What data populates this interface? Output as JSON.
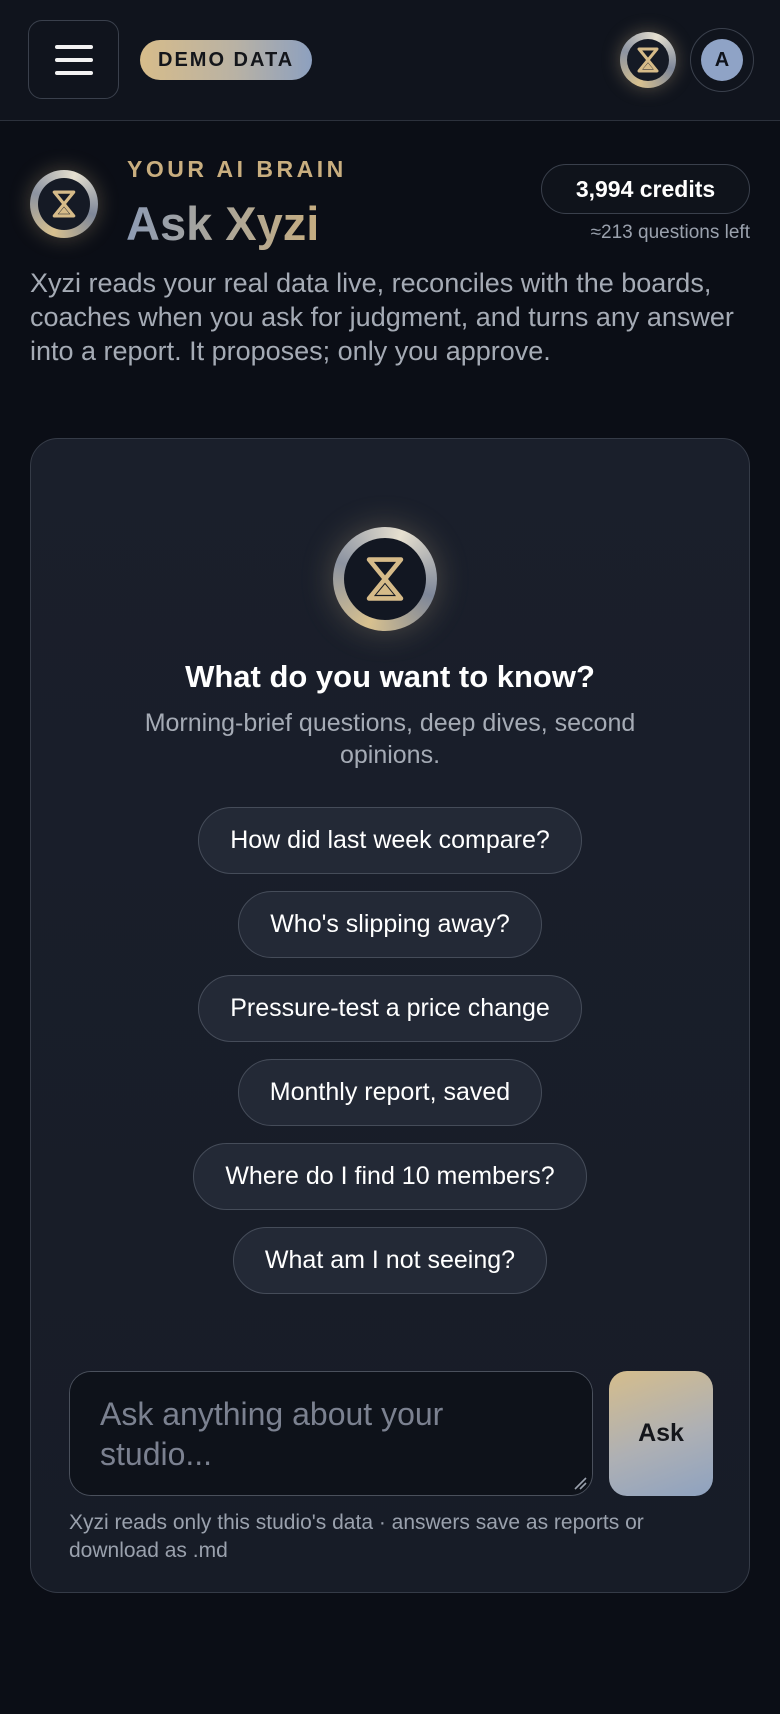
{
  "header": {
    "menu_icon": "hamburger-icon",
    "demo_badge": "DEMO DATA",
    "brand_icon": "hourglass-icon",
    "avatar_initial": "A"
  },
  "hero": {
    "eyebrow": "YOUR AI BRAIN",
    "title": "Ask Xyzi",
    "credits": "3,994 credits",
    "questions_left": "≈213 questions left",
    "description": "Xyzi reads your real data live, reconciles with the boards, coaches when you ask for judgment, and turns any answer into a report. It proposes; only you approve."
  },
  "card": {
    "title": "What do you want to know?",
    "subtitle": "Morning-brief questions, deep dives, second opinions.",
    "suggestions": [
      "How did last week compare?",
      "Who's slipping away?",
      "Pressure-test a price change",
      "Monthly report, saved",
      "Where do I find 10 members?",
      "What am I not seeing?"
    ],
    "input": {
      "placeholder": "Ask anything about your studio...",
      "value": ""
    },
    "ask_label": "Ask",
    "footer": "Xyzi reads only this studio's data · answers save as reports or download as .md"
  },
  "colors": {
    "background": "#0b0e16",
    "gold_accent": "#c9ae7f",
    "blue_accent": "#8fa3c6",
    "card_bg": "#1a1f2b"
  }
}
